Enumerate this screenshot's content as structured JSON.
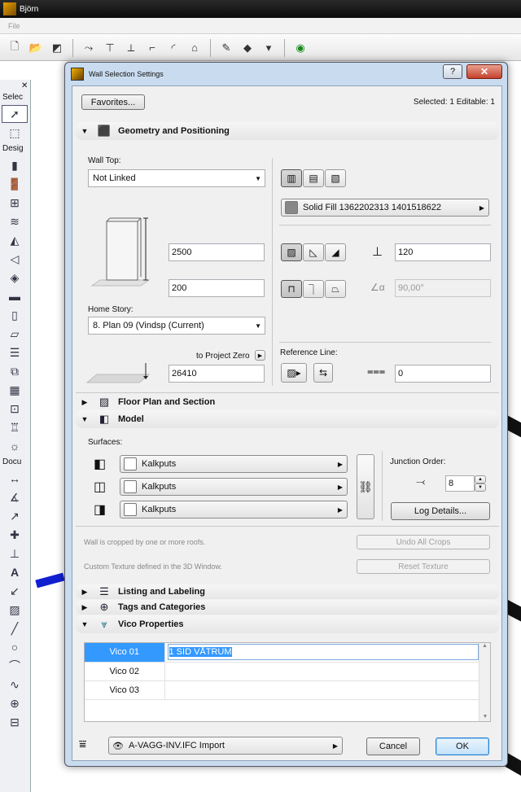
{
  "app": {
    "title": "Björn",
    "menu_first": "File"
  },
  "toolbox": {
    "select_header": "Selec",
    "design_header": "Desig",
    "document_header": "Docu"
  },
  "dialog": {
    "title": "Wall Selection Settings",
    "help_label": "?",
    "close_label": "✕",
    "favorites_label": "Favorites...",
    "selected_info": "Selected: 1 Editable: 1",
    "sections": {
      "geometry": "Geometry and Positioning",
      "floor_plan": "Floor Plan and Section",
      "model": "Model",
      "listing": "Listing and Labeling",
      "tags": "Tags and Categories",
      "vico": "Vico Properties"
    },
    "geometry": {
      "wall_top_label": "Wall Top:",
      "wall_top_value": "Not Linked",
      "height_value": "2500",
      "offset_value": "200",
      "home_story_label": "Home Story:",
      "home_story_value": "8. Plan 09 (Vindsp (Current)",
      "to_project_zero_label": "to Project Zero",
      "elevation_value": "26410",
      "fill_value": "Solid Fill 1362202313 1401518622",
      "thickness_value": "120",
      "angle_value": "90,00°",
      "reference_line_label": "Reference Line:",
      "ref_offset_value": "0"
    },
    "model": {
      "surfaces_label": "Surfaces:",
      "surface_values": [
        "Kalkputs",
        "Kalkputs",
        "Kalkputs"
      ],
      "junction_order_label": "Junction Order:",
      "junction_order_value": "8",
      "log_details_label": "Log Details...",
      "crop_note": "Wall is cropped by one or more roofs.",
      "undo_crops_label": "Undo All Crops",
      "texture_note": "Custom Texture defined in the 3D Window.",
      "reset_texture_label": "Reset Texture"
    },
    "vico": {
      "rows": [
        {
          "name": "Vico 01",
          "value": "1 SID VÅTRUM"
        },
        {
          "name": "Vico 02",
          "value": ""
        },
        {
          "name": "Vico 03",
          "value": ""
        }
      ]
    },
    "footer": {
      "layer_value": "A-VAGG-INV.IFC Import",
      "cancel_label": "Cancel",
      "ok_label": "OK"
    }
  }
}
